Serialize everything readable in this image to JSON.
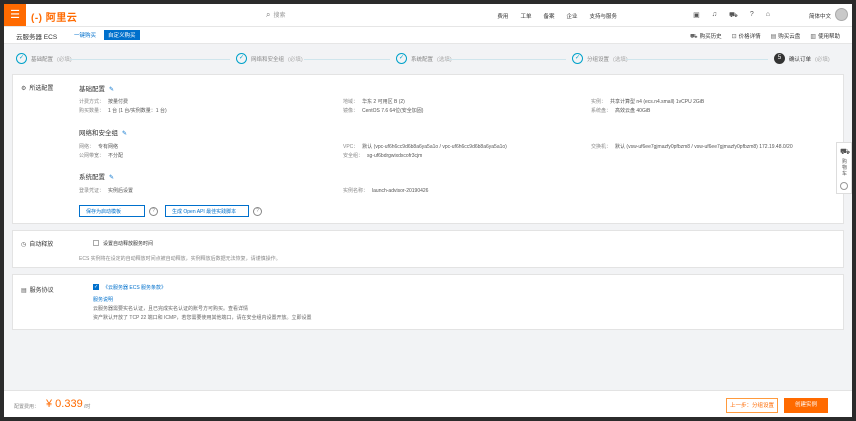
{
  "topbar": {
    "menu_icon": "hamburger-icon",
    "logo": "(-) 阿里云",
    "search_placeholder": "搜索",
    "nav": [
      "费用",
      "工单",
      "备案",
      "企业",
      "支持与服务"
    ],
    "lang": "简体中文"
  },
  "subbar": {
    "title": "云服务器 ECS",
    "tab_quick": "一键购买",
    "tab_custom": "自定义购买",
    "links": [
      "购买历史",
      "价格详情",
      "购买云盘",
      "使用帮助"
    ]
  },
  "steps": [
    {
      "label": "基础配置",
      "sub": "(必填)"
    },
    {
      "label": "网络和安全组",
      "sub": "(必填)"
    },
    {
      "label": "系统配置",
      "sub": "(选填)"
    },
    {
      "label": "分组设置",
      "sub": "(选填)"
    },
    {
      "num": "5",
      "label": "确认订单",
      "sub": "(必填)"
    }
  ],
  "config_panel": {
    "title": "所选配置",
    "basic": {
      "heading": "基础配置",
      "billing": {
        "k": "计费方式：",
        "v": "按量付费"
      },
      "count": {
        "k": "购买数量：",
        "v": "1 台 (1 台/实例数量：1 台)"
      },
      "region": {
        "k": "地域：",
        "v": "华东 2 可用区 B (2)"
      },
      "image": {
        "k": "镜像：",
        "v": "CentOS 7.6 64位(安全加固)"
      },
      "instance": {
        "k": "实例：",
        "v": "共享计算型 n4 (ecs.n4.small) 1vCPU 2GiB"
      },
      "disk": {
        "k": "系统盘：",
        "v": "高效云盘 40GiB"
      }
    },
    "network": {
      "heading": "网络和安全组",
      "net": {
        "k": "网络：",
        "v": "专有网络"
      },
      "ip": {
        "k": "公网带宽：",
        "v": "不分配"
      },
      "vpc": {
        "k": "VPC：",
        "v": "默认 (vpc-uf6h6cc9d6b8a6ya5a1o / vpc-uf6h6cc9d6b8a6ya5a1o)"
      },
      "sg": {
        "k": "安全组：",
        "v": "sg-uf6bdrgwixdxcofr3cjm"
      },
      "vswitch": {
        "k": "交换机：",
        "v": "默认 (vsw-uf6ee7gjmazfy0pfbzm8 / vsw-uf6ee7gjmazfy0pfbzm8) 172.19.48.0/20"
      }
    },
    "system": {
      "heading": "系统配置",
      "login": {
        "k": "登录凭证：",
        "v": "实例后设置"
      },
      "name": {
        "k": "实例名称：",
        "v": "launch-advisor-20190426"
      }
    },
    "btn_save": "保存为启动模板",
    "btn_api": "生成 Open API 最佳实践脚本"
  },
  "release_panel": {
    "title": "自动释放",
    "checkbox": "设置自动释放服务时间",
    "hint": "ECS 实例将在设定的自动释放时间点被自动释放，实例释放后数据无法恢复，请谨慎操作。"
  },
  "tos_panel": {
    "title": "服务协议",
    "checkbox": "《云服务器 ECS 服务条款》",
    "link": "服务说明",
    "line1": "云服务器需要实名认证，且已完成实名认证的账号方可购买。查看详情",
    "line2": "资产默认开放了 TCP 22 端口和 ICMP，若您需要使用其他端口，请在安全组内设置开放。立即设置"
  },
  "footer": {
    "fee_label": "配置费用：",
    "price": "¥ 0.339",
    "unit": "/时",
    "prev": "上一步：分组设置",
    "create": "创建实例"
  },
  "side": {
    "cart": "购物车"
  }
}
